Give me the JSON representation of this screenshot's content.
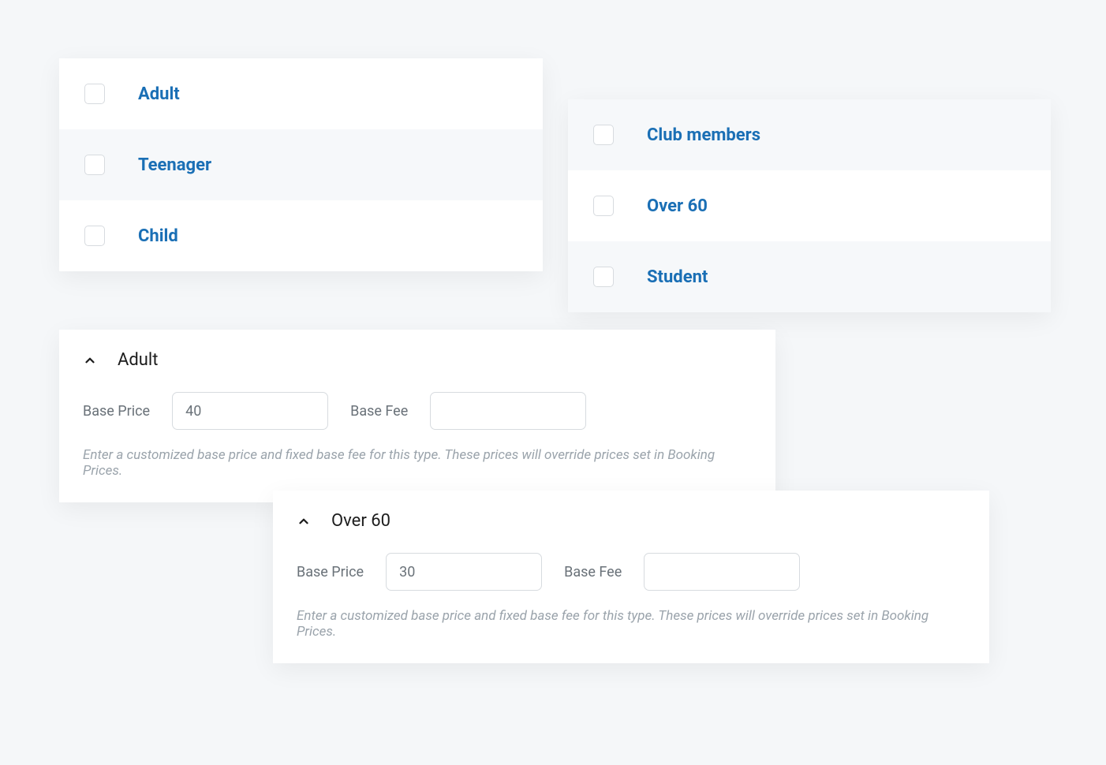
{
  "left_list": {
    "items": [
      {
        "label": "Adult"
      },
      {
        "label": "Teenager"
      },
      {
        "label": "Child"
      }
    ]
  },
  "right_list": {
    "items": [
      {
        "label": "Club members"
      },
      {
        "label": "Over 60"
      },
      {
        "label": "Student"
      }
    ]
  },
  "panel1": {
    "title": "Adult",
    "base_price_label": "Base Price",
    "base_price_value": "40",
    "base_fee_label": "Base Fee",
    "base_fee_value": "",
    "helper": "Enter a customized base price and fixed base fee for this type. These prices will override prices set in Booking Prices."
  },
  "panel2": {
    "title": "Over 60",
    "base_price_label": "Base Price",
    "base_price_value": "30",
    "base_fee_label": "Base Fee",
    "base_fee_value": "",
    "helper": "Enter a customized base price and fixed base fee for this type. These prices will override prices set in Booking Prices."
  }
}
